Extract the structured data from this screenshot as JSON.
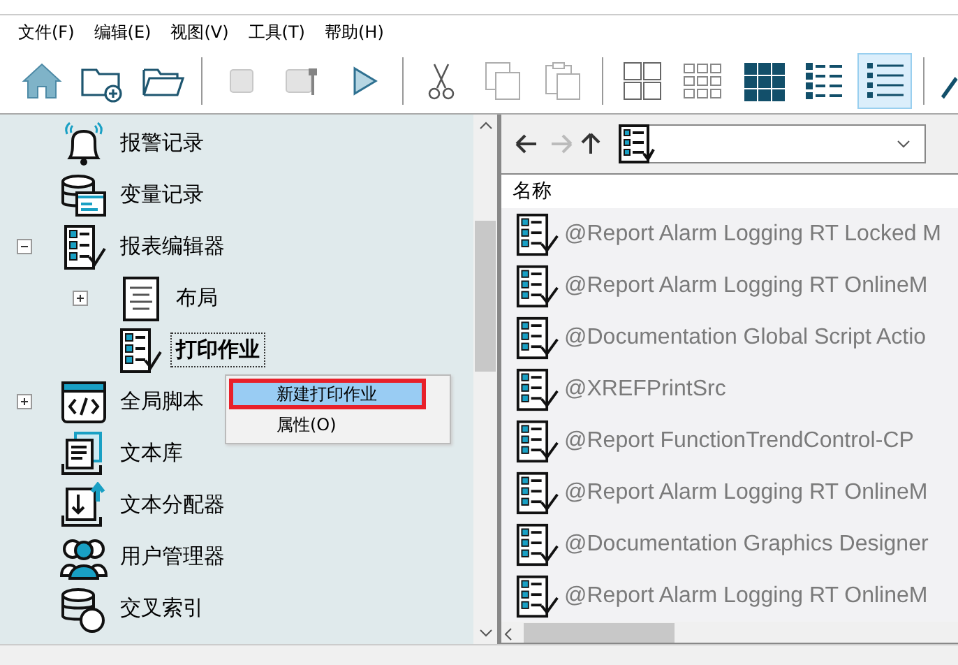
{
  "menu": [
    "文件(F)",
    "编辑(E)",
    "视图(V)",
    "工具(T)",
    "帮助(H)"
  ],
  "toolbar": [
    [
      {
        "kind": "home",
        "disabled": false
      },
      {
        "kind": "new-folder",
        "disabled": false
      },
      {
        "kind": "open-folder",
        "disabled": false
      }
    ],
    [
      {
        "kind": "stop",
        "disabled": true
      },
      {
        "kind": "wrench",
        "disabled": true
      },
      {
        "kind": "play",
        "disabled": false
      }
    ],
    [
      {
        "kind": "cut",
        "disabled": false
      },
      {
        "kind": "copy",
        "disabled": true
      },
      {
        "kind": "paste",
        "disabled": true
      }
    ],
    [
      {
        "kind": "large-icons",
        "selected": false
      },
      {
        "kind": "small-icons",
        "selected": false
      },
      {
        "kind": "tiles",
        "selected": false
      },
      {
        "kind": "details",
        "selected": false
      },
      {
        "kind": "list",
        "selected": true
      }
    ]
  ],
  "tree": [
    {
      "label": "报警记录",
      "kind": "bell",
      "selected": false
    },
    {
      "label": "变量记录",
      "kind": "database",
      "selected": false
    },
    {
      "label": "报表编辑器",
      "kind": "report",
      "selected": false,
      "expanded": true,
      "children": [
        {
          "label": "布局",
          "kind": "page",
          "selected": false,
          "expanded": false
        },
        {
          "label": "打印作业",
          "kind": "report",
          "selected": true
        }
      ]
    },
    {
      "label": "全局脚本",
      "kind": "code",
      "selected": false,
      "expanded": false
    },
    {
      "label": "文本库",
      "kind": "texts",
      "selected": false
    },
    {
      "label": "文本分配器",
      "kind": "import",
      "selected": false
    },
    {
      "label": "用户管理器",
      "kind": "users",
      "selected": false
    },
    {
      "label": "交叉索引",
      "kind": "xref",
      "selected": false
    }
  ],
  "context_menu": [
    {
      "label": "新建打印作业",
      "selected": true
    },
    {
      "label": "属性(O)",
      "selected": false
    }
  ],
  "list": {
    "column": "名称",
    "rows": [
      "@Report Alarm Logging RT Locked M",
      "@Report Alarm Logging RT OnlineM",
      "@Documentation Global Script Actio",
      "@XREFPrintSrc",
      "@Report FunctionTrendControl-CP",
      "@Report Alarm Logging RT OnlineM",
      "@Documentation Graphics Designer",
      "@Report Alarm Logging RT OnlineM"
    ]
  }
}
